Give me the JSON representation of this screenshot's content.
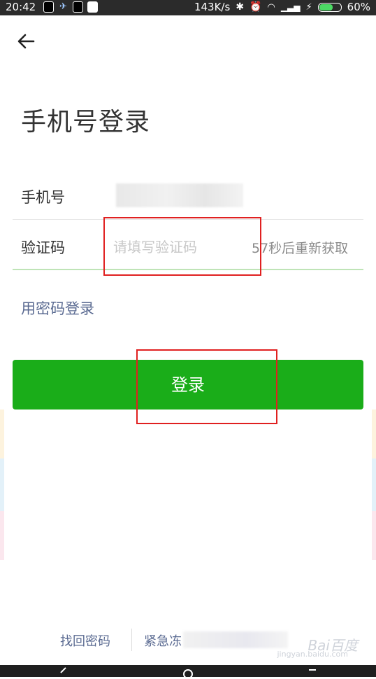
{
  "status_bar": {
    "time": "20:42",
    "speed": "143K/s",
    "battery": "60%"
  },
  "header": {
    "title": "手机号登录"
  },
  "form": {
    "phone_label": "手机号",
    "phone_value": "+",
    "code_label": "验证码",
    "code_placeholder": "请填写验证码",
    "resend_text": "57秒后重新获取",
    "password_login_link": "用密码登录",
    "login_button": "登录"
  },
  "footer": {
    "find_password": "找回密码",
    "emergency_freeze": "紧急冻"
  },
  "watermark": {
    "brand": "Bai百度",
    "sub": "jingyan.baidu.com"
  },
  "colors": {
    "primary_green": "#1aad19",
    "link_blue": "#5b6b92",
    "annotation_red": "#e02020"
  }
}
